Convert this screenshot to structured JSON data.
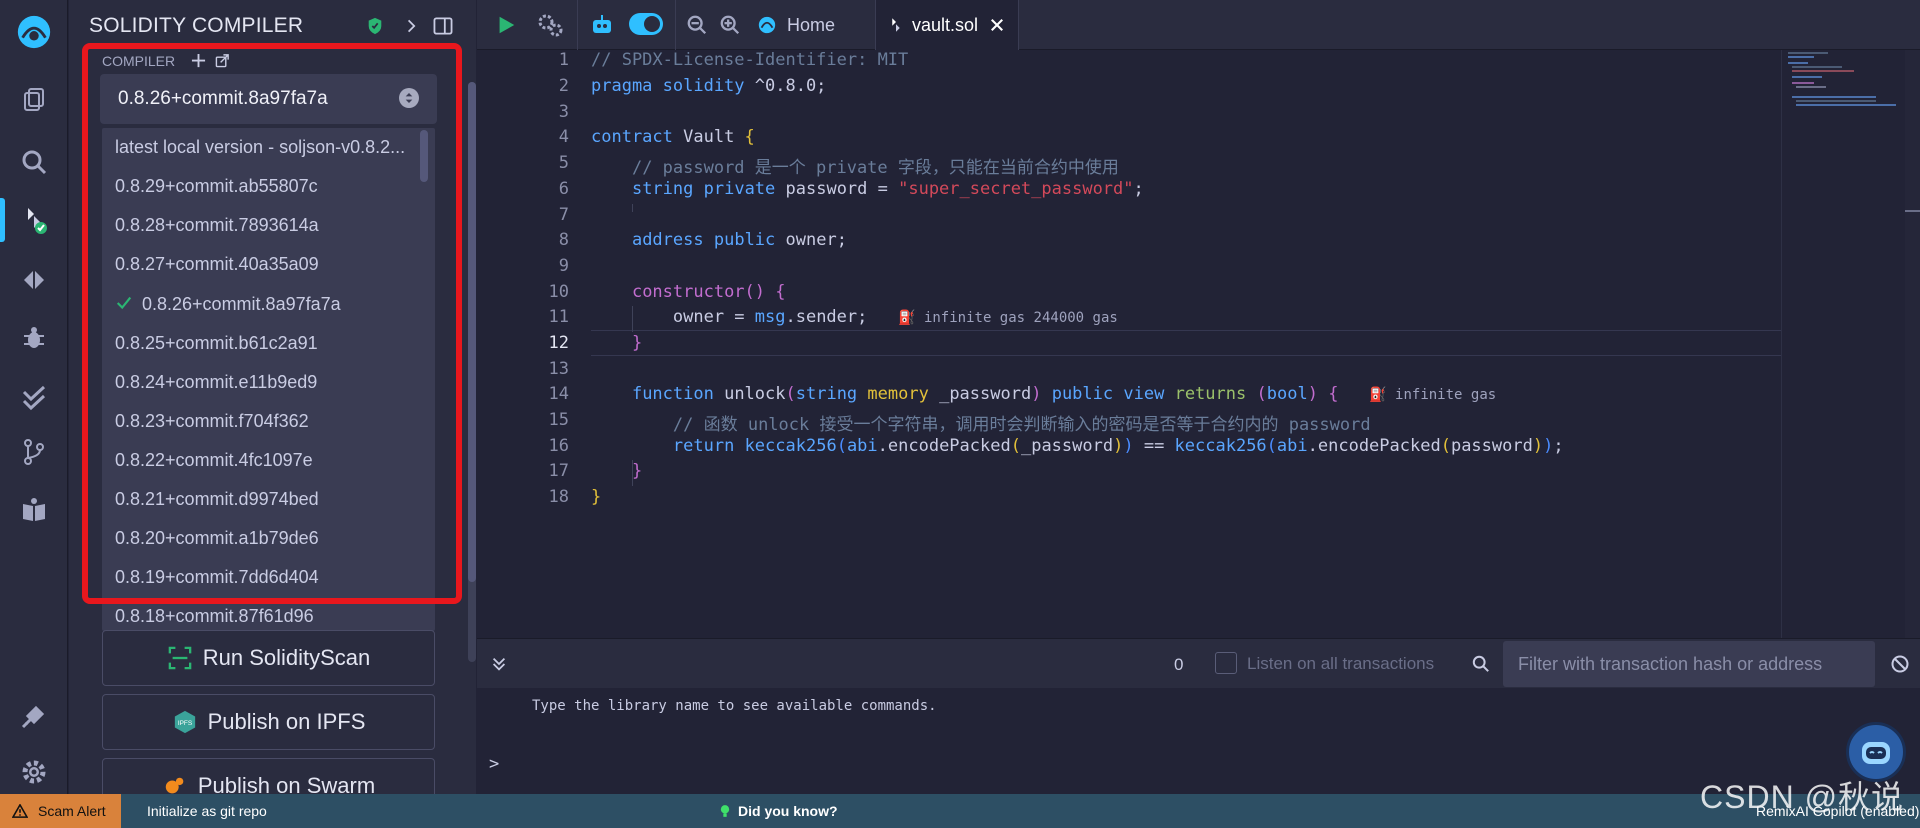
{
  "app": {
    "accent": "#2fbfff",
    "highlight_frame_color": "#e8171d"
  },
  "rail": {
    "icons": [
      "remix-logo-icon",
      "file-explorer-icon",
      "search-icon",
      "solidity-compiler-icon",
      "deploy-run-icon",
      "debugger-icon",
      "solidity-static-analysis-icon",
      "git-branch-icon",
      "learneth-icon",
      "plugin-manager-icon",
      "settings-icon"
    ]
  },
  "sidepanel": {
    "title": "SOLIDITY COMPILER",
    "compiler_label": "COMPILER",
    "selected_version": "0.8.26+commit.8a97fa7a",
    "versions": [
      "latest local version - soljson-v0.8.2...",
      "0.8.29+commit.ab55807c",
      "0.8.28+commit.7893614a",
      "0.8.27+commit.40a35a09",
      "0.8.26+commit.8a97fa7a",
      "0.8.25+commit.b61c2a91",
      "0.8.24+commit.e11b9ed9",
      "0.8.23+commit.f704f362",
      "0.8.22+commit.4fc1097e",
      "0.8.21+commit.d9974bed",
      "0.8.20+commit.a1b79de6",
      "0.8.19+commit.7dd6d404",
      "0.8.18+commit.87f61d96"
    ],
    "selected_index": 4,
    "actions": [
      "Run SolidityScan",
      "Publish on IPFS",
      "Publish on Swarm"
    ]
  },
  "topbar": {
    "home_label": "Home",
    "file_tab_label": "vault.sol"
  },
  "editor": {
    "line_numbers": [
      "1",
      "2",
      "3",
      "4",
      "5",
      "6",
      "7",
      "8",
      "9",
      "10",
      "11",
      "12",
      "13",
      "14",
      "15",
      "16",
      "17",
      "18"
    ],
    "current_line": 12,
    "gas_hint_constructor": "infinite gas 244000 gas",
    "gas_hint_unlock": "infinite gas"
  },
  "terminal": {
    "count": "0",
    "listen_label": "Listen on all transactions",
    "filter_placeholder": "Filter with transaction hash or address",
    "welcome_text": "Type the library name to see available commands.",
    "prompt": ">"
  },
  "statusbar": {
    "scam_alert": "Scam Alert",
    "git_init": "Initialize as git repo",
    "did_you_know": "Did you know?",
    "copilot": "RemixAI Copilot (enabled)"
  },
  "watermark": "CSDN @秋说"
}
